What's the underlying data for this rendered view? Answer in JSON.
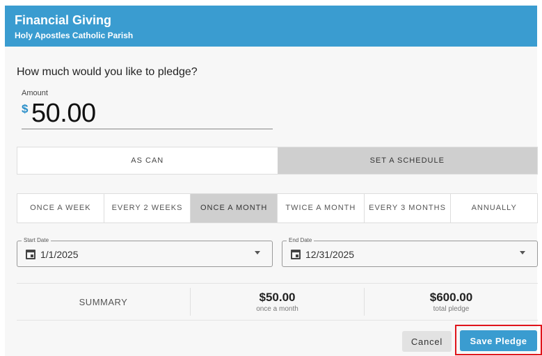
{
  "header": {
    "title": "Financial Giving",
    "subtitle": "Holy Apostles Catholic Parish"
  },
  "pledge": {
    "question": "How much would you like to pledge?",
    "amount_label": "Amount",
    "currency_symbol": "$",
    "amount_value": "50.00"
  },
  "mode": {
    "options": [
      "AS CAN",
      "SET A SCHEDULE"
    ],
    "selected": "SET A SCHEDULE"
  },
  "frequency": {
    "options": [
      "ONCE A WEEK",
      "EVERY 2 WEEKS",
      "ONCE A MONTH",
      "TWICE A MONTH",
      "EVERY 3 MONTHS",
      "ANNUALLY"
    ],
    "selected": "ONCE A MONTH"
  },
  "dates": {
    "start_label": "Start Date",
    "start_value": "1/1/2025",
    "end_label": "End Date",
    "end_value": "12/31/2025"
  },
  "summary": {
    "label": "SUMMARY",
    "per_period_amount": "$50.00",
    "per_period_caption": "once a month",
    "total_amount": "$600.00",
    "total_caption": "total pledge"
  },
  "actions": {
    "cancel_label": "Cancel",
    "save_label": "Save Pledge"
  },
  "colors": {
    "brand_blue": "#3a9cd0",
    "highlight_red": "#e0141b",
    "selected_gray": "#cfcfcf"
  },
  "icons": {
    "date_field": "calendar-icon",
    "dropdown": "caret-down-icon"
  }
}
